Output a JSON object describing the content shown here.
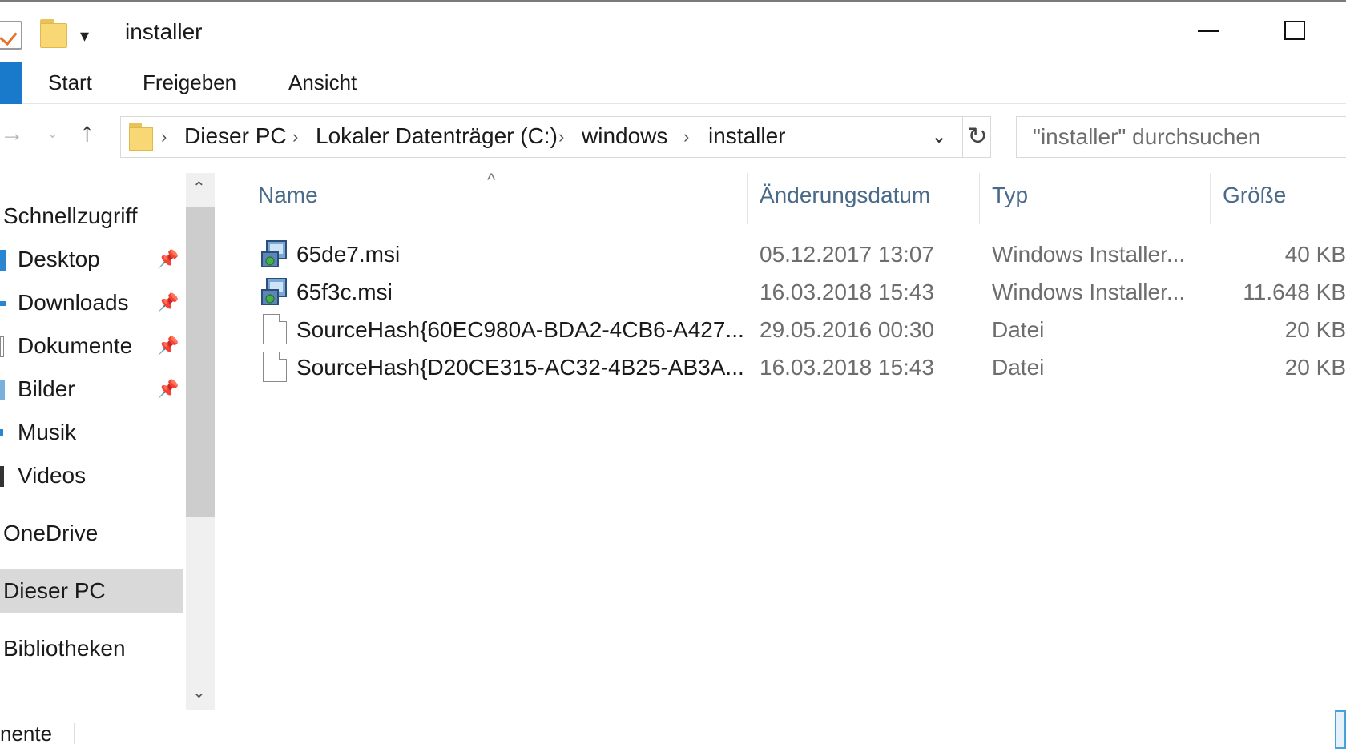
{
  "window": {
    "title": "installer",
    "quick_access_dropdown": "▾",
    "minimize": "",
    "maximize": ""
  },
  "ribbon": {
    "tabs": [
      "Start",
      "Freigeben",
      "Ansicht"
    ]
  },
  "nav": {
    "back": "→",
    "recent": "⌄",
    "up": "↑"
  },
  "address": {
    "crumbs": [
      "Dieser PC",
      "Lokaler Datenträger (C:)",
      "windows",
      "installer"
    ],
    "separator": "›",
    "dropdown": "⌄",
    "refresh": "↻"
  },
  "search": {
    "placeholder": "\"installer\" durchsuchen"
  },
  "navpane": {
    "quick_access": "Schnellzugriff",
    "items": [
      {
        "label": "Desktop",
        "pinned": true
      },
      {
        "label": "Downloads",
        "pinned": true
      },
      {
        "label": "Dokumente",
        "pinned": true
      },
      {
        "label": "Bilder",
        "pinned": true
      },
      {
        "label": "Musik",
        "pinned": false
      },
      {
        "label": "Videos",
        "pinned": false
      }
    ],
    "onedrive": "OneDrive",
    "this_pc": "Dieser PC",
    "libraries": "Bibliotheken",
    "pin_glyph": "📌",
    "scroll_up": "⌃",
    "scroll_down": "⌄"
  },
  "filelist": {
    "sort_indicator": "^",
    "columns": [
      "Name",
      "Änderungsdatum",
      "Typ",
      "Größe"
    ],
    "files": [
      {
        "name": "65de7.msi",
        "date": "05.12.2017 13:07",
        "type": "Windows Installer...",
        "size": "40 KB",
        "icon": "msi-icon"
      },
      {
        "name": "65f3c.msi",
        "date": "16.03.2018 15:43",
        "type": "Windows Installer...",
        "size": "11.648 KB",
        "icon": "msi-icon"
      },
      {
        "name": "SourceHash{60EC980A-BDA2-4CB6-A427...",
        "date": "29.05.2016 00:30",
        "type": "Datei",
        "size": "20 KB",
        "icon": "file-icon"
      },
      {
        "name": "SourceHash{D20CE315-AC32-4B25-AB3A...",
        "date": "16.03.2018 15:43",
        "type": "Datei",
        "size": "20 KB",
        "icon": "file-icon"
      }
    ]
  },
  "statusbar": {
    "text": "nente"
  },
  "colors": {
    "file_tab": "#1979ca",
    "selection": "#d9d9d9",
    "folder": "#f8d775",
    "column_header": "#4a6a8a"
  }
}
